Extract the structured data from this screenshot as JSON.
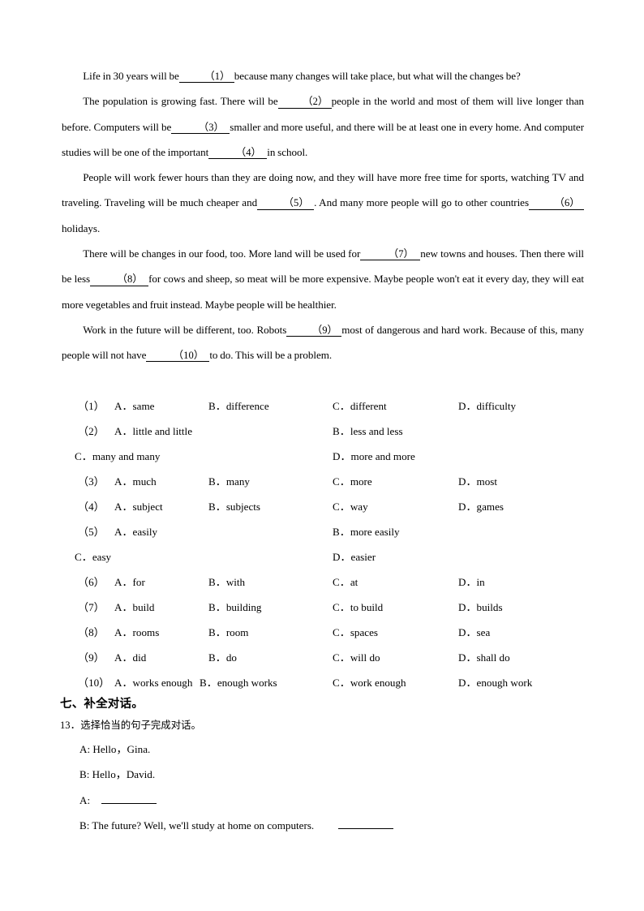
{
  "passage": {
    "paragraphs": [
      {
        "id": "p1",
        "segments": [
          {
            "type": "text",
            "value": "Life in 30 years will be"
          },
          {
            "type": "blank",
            "value": "（1）"
          },
          {
            "type": "text",
            "value": "because many changes will take place, but what will the changes be?"
          }
        ]
      },
      {
        "id": "p2",
        "segments": [
          {
            "type": "text",
            "value": "The population is growing fast. There will be"
          },
          {
            "type": "blank",
            "value": "（2）"
          },
          {
            "type": "text",
            "value": "people in the world and most of them will live longer than before. Computers will be"
          },
          {
            "type": "blank",
            "value": "（3）"
          },
          {
            "type": "text",
            "value": "smaller and more useful, and there will be at least one in every home. And computer studies will be one of the important"
          },
          {
            "type": "blank",
            "value": "（4）"
          },
          {
            "type": "text",
            "value": "in school."
          }
        ]
      },
      {
        "id": "p3",
        "segments": [
          {
            "type": "text",
            "value": "People will work fewer hours than they are doing now, and they will have more free time for sports, watching TV and traveling. Traveling will be much cheaper and"
          },
          {
            "type": "blank",
            "value": "（5）"
          },
          {
            "type": "text",
            "value": ". And many more people will go to other countries"
          },
          {
            "type": "blank",
            "value": "（6）"
          },
          {
            "type": "text",
            "value": "holidays."
          }
        ]
      },
      {
        "id": "p4",
        "segments": [
          {
            "type": "text",
            "value": "There will be changes in our food, too. More land will be used for"
          },
          {
            "type": "blank",
            "value": "（7）"
          },
          {
            "type": "text",
            "value": "new towns and houses. Then there will be less"
          },
          {
            "type": "blank",
            "value": "（8）"
          },
          {
            "type": "text",
            "value": "for cows and sheep, so meat will be more expensive. Maybe people won't eat it every day, they will eat more vegetables and fruit instead. Maybe people will be healthier."
          }
        ]
      },
      {
        "id": "p5",
        "segments": [
          {
            "type": "text",
            "value": "Work in the future will be different, too. Robots"
          },
          {
            "type": "blank",
            "value": "（9）"
          },
          {
            "type": "text",
            "value": "most of dangerous and hard work. Because of this, many people will not have"
          },
          {
            "type": "blank",
            "value": "（10）"
          },
          {
            "type": "text",
            "value": "to do. This will be a problem."
          }
        ]
      }
    ]
  },
  "options": [
    {
      "number": "（1）",
      "layout": "single",
      "a": "A．same",
      "b": "B．difference",
      "c": "C．different",
      "d": "D．difficulty"
    },
    {
      "number": "（2）",
      "layout": "wrapped",
      "a": "A．little and little",
      "b": "B．less and less",
      "c": "C．many and many",
      "d": "D．more and more"
    },
    {
      "number": "（3）",
      "layout": "single",
      "a": "A．much",
      "b": "B．many",
      "c": "C．more",
      "d": "D．most"
    },
    {
      "number": "（4）",
      "layout": "single",
      "a": "A．subject",
      "b": "B．subjects",
      "c": "C．way",
      "d": "D．games"
    },
    {
      "number": "（5）",
      "layout": "wrapped",
      "a": "A．easily",
      "b": "B．more easily",
      "c": "C．easy",
      "d": "D．easier"
    },
    {
      "number": "（6）",
      "layout": "single",
      "a": "A．for",
      "b": "B．with",
      "c": "C．at",
      "d": "D．in"
    },
    {
      "number": "（7）",
      "layout": "single",
      "a": "A．build",
      "b": "B．building",
      "c": "C．to build",
      "d": "D．builds"
    },
    {
      "number": "（8）",
      "layout": "single",
      "a": "A．rooms",
      "b": "B．room",
      "c": "C．spaces",
      "d": "D．sea"
    },
    {
      "number": "（9）",
      "layout": "single",
      "a": "A．did",
      "b": "B．do",
      "c": "C．will do",
      "d": "D．shall do"
    },
    {
      "number": "（10）",
      "layout": "single-tight",
      "a": "A．works enough",
      "b": "B．enough works",
      "c": "C．work enough",
      "d": "D．enough work"
    }
  ],
  "section": {
    "heading": "七、补全对话。",
    "question_number": "13．",
    "question_text": "选择恰当的句子完成对话。"
  },
  "dialogue": [
    {
      "id": "d1",
      "text": "A: Hello，Gina.",
      "blank": "none"
    },
    {
      "id": "d2",
      "text": "B: Hello，David.",
      "blank": "none"
    },
    {
      "id": "d3",
      "text": "A:",
      "blank": "lead"
    },
    {
      "id": "d4",
      "text": "B: The future? Well, we'll study at home on computers.",
      "blank": "trail"
    }
  ]
}
